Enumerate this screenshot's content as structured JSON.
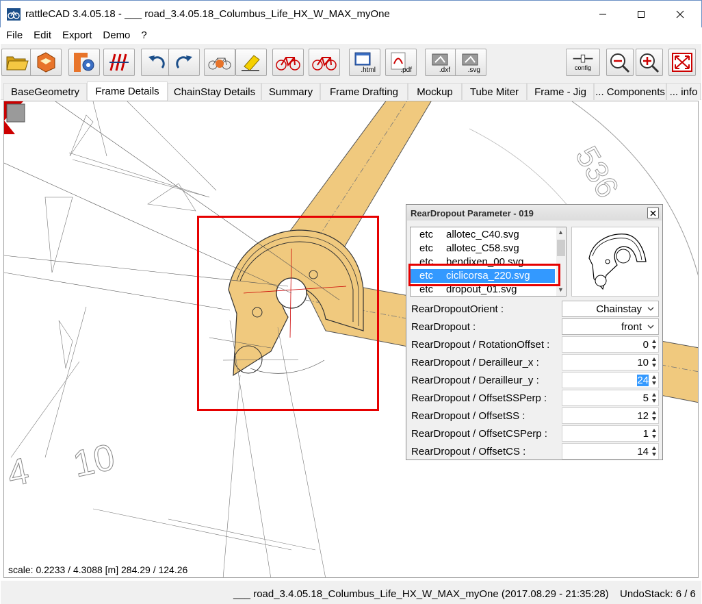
{
  "window": {
    "title": "rattleCAD  3.4.05.18 - ___ road_3.4.05.18_Columbus_Life_HX_W_MAX_myOne"
  },
  "menu": [
    "File",
    "Edit",
    "Export",
    "Demo",
    "?"
  ],
  "toolbar": {
    "buttons": [
      {
        "icon": "open-folder-icon"
      },
      {
        "icon": "save-icon"
      },
      {
        "icon": "frame-settings-icon"
      },
      {
        "icon": "dimension-icon"
      },
      {
        "icon": "undo-icon"
      },
      {
        "icon": "redo-icon"
      },
      {
        "icon": "bike-reset-icon"
      },
      {
        "icon": "eraser-icon"
      },
      {
        "icon": "bike-red-icon"
      },
      {
        "icon": "bike-red-icon"
      },
      {
        "icon": "export-html-icon",
        "label": ".html"
      },
      {
        "icon": "export-pdf-icon",
        "label": ".pdf"
      },
      {
        "icon": "export-dxf-icon",
        "label": ".dxf"
      },
      {
        "icon": "export-svg-icon",
        "label": ".svg"
      },
      {
        "icon": "config-icon",
        "label": "config"
      },
      {
        "icon": "zoom-out-icon"
      },
      {
        "icon": "zoom-in-icon"
      },
      {
        "icon": "fit-to-window-icon"
      }
    ]
  },
  "tabs": [
    {
      "label": "BaseGeometry",
      "active": false
    },
    {
      "label": "Frame Details",
      "active": true
    },
    {
      "label": "ChainStay Details",
      "active": false
    },
    {
      "label": "Summary",
      "active": false
    },
    {
      "label": "Frame Drafting",
      "active": false
    },
    {
      "label": "Mockup",
      "active": false
    },
    {
      "label": "Tube Miter",
      "active": false
    },
    {
      "label": "Frame - Jig",
      "active": false
    },
    {
      "label": "... Components",
      "active": false
    },
    {
      "label": "... info",
      "active": false
    }
  ],
  "canvas": {
    "scale_text": "scale: 0.2233 / 4.3088  [m]  284.29 / 124.26",
    "dimension_labels": [
      "10",
      "4",
      "536"
    ]
  },
  "dialog": {
    "title": "RearDropout Parameter - 019",
    "files": [
      {
        "dir": "etc",
        "name": "allotec_C40.svg",
        "selected": false
      },
      {
        "dir": "etc",
        "name": "allotec_C58.svg",
        "selected": false
      },
      {
        "dir": "etc",
        "name": "bendixen_00.svg",
        "selected": false
      },
      {
        "dir": "etc",
        "name": "ciclicorsa_220.svg",
        "selected": true
      },
      {
        "dir": "etc",
        "name": "dropout_01.svg",
        "selected": false
      }
    ],
    "params": [
      {
        "label": "RearDropoutOrient  :",
        "type": "select",
        "value": "Chainstay"
      },
      {
        "label": "RearDropout  :",
        "type": "select",
        "value": "front"
      },
      {
        "label": "RearDropout / RotationOffset  :",
        "type": "spin",
        "value": "0"
      },
      {
        "label": "RearDropout / Derailleur_x  :",
        "type": "spin",
        "value": "10"
      },
      {
        "label": "RearDropout / Derailleur_y  :",
        "type": "spin",
        "value": "24",
        "highlighted": true
      },
      {
        "label": "RearDropout / OffsetSSPerp  :",
        "type": "spin",
        "value": "5"
      },
      {
        "label": "RearDropout / OffsetSS  :",
        "type": "spin",
        "value": "12"
      },
      {
        "label": "RearDropout / OffsetCSPerp  :",
        "type": "spin",
        "value": "1"
      },
      {
        "label": "RearDropout / OffsetCS  :",
        "type": "spin",
        "value": "14"
      }
    ]
  },
  "status": {
    "file_info": "___ road_3.4.05.18_Columbus_Life_HX_W_MAX_myOne (2017.08.29 - 21:35:28)",
    "undo_stack": "UndoStack:  6 /  6"
  },
  "colors": {
    "frame_fill": "#f0c97e",
    "highlight": "#e60000",
    "selection": "#3399ff"
  }
}
